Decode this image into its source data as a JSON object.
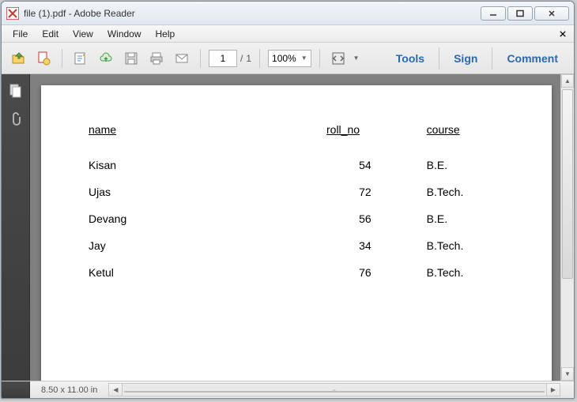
{
  "window": {
    "title": "file (1).pdf - Adobe Reader"
  },
  "menu": {
    "file": "File",
    "edit": "Edit",
    "view": "View",
    "window": "Window",
    "help": "Help"
  },
  "toolbar": {
    "page_current": "1",
    "page_sep": "/",
    "page_total": "1",
    "zoom": "100%"
  },
  "side_actions": {
    "tools": "Tools",
    "sign": "Sign",
    "comment": "Comment"
  },
  "doc": {
    "headers": {
      "name": "name",
      "roll": "roll_no",
      "course": "course"
    },
    "rows": [
      {
        "name": "Kisan",
        "roll": "54",
        "course": "B.E."
      },
      {
        "name": "Ujas",
        "roll": "72",
        "course": "B.Tech."
      },
      {
        "name": "Devang",
        "roll": "56",
        "course": "B.E."
      },
      {
        "name": "Jay",
        "roll": "34",
        "course": "B.Tech."
      },
      {
        "name": "Ketul",
        "roll": "76",
        "course": "B.Tech."
      }
    ]
  },
  "status": {
    "page_size": "8.50 x 11.00 in"
  }
}
